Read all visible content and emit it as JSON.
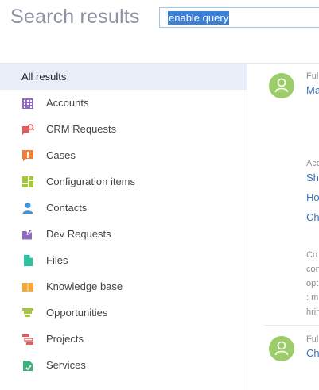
{
  "header": {
    "title": "Search results",
    "search_value": "enable query"
  },
  "sidebar": {
    "items": [
      {
        "label": "All results",
        "icon": "none",
        "active": true
      },
      {
        "label": "Accounts",
        "icon": "building-icon",
        "color": "#8e6bbf"
      },
      {
        "label": "CRM Requests",
        "icon": "request-search-icon",
        "color": "#e25c57"
      },
      {
        "label": "Cases",
        "icon": "exclamation-bubble-icon",
        "color": "#f07d3a"
      },
      {
        "label": "Configuration items",
        "icon": "config-blocks-icon",
        "color": "#a5c83a"
      },
      {
        "label": "Contacts",
        "icon": "person-icon",
        "color": "#3f95db"
      },
      {
        "label": "Dev Requests",
        "icon": "folder-edit-icon",
        "color": "#8e6bbf"
      },
      {
        "label": "Files",
        "icon": "file-icon",
        "color": "#2ec3a0"
      },
      {
        "label": "Knowledge base",
        "icon": "book-icon",
        "color": "#f2a93b"
      },
      {
        "label": "Opportunities",
        "icon": "funnel-icon",
        "color": "#a5c83a"
      },
      {
        "label": "Projects",
        "icon": "gantt-icon",
        "color": "#e25c57"
      },
      {
        "label": "Services",
        "icon": "service-icon",
        "color": "#3fb07c"
      }
    ]
  },
  "results": {
    "r1_label": "Ful",
    "r1_link": "Ma",
    "r2_label": "Acc",
    "r2_link1": "Sh",
    "r2_link2": "Ho",
    "r2_link3": "Ch",
    "snippet": [
      "Co",
      "con",
      "opt",
      ": m",
      "hrin"
    ],
    "r3_label": "Ful",
    "r3_link": "Ch"
  }
}
